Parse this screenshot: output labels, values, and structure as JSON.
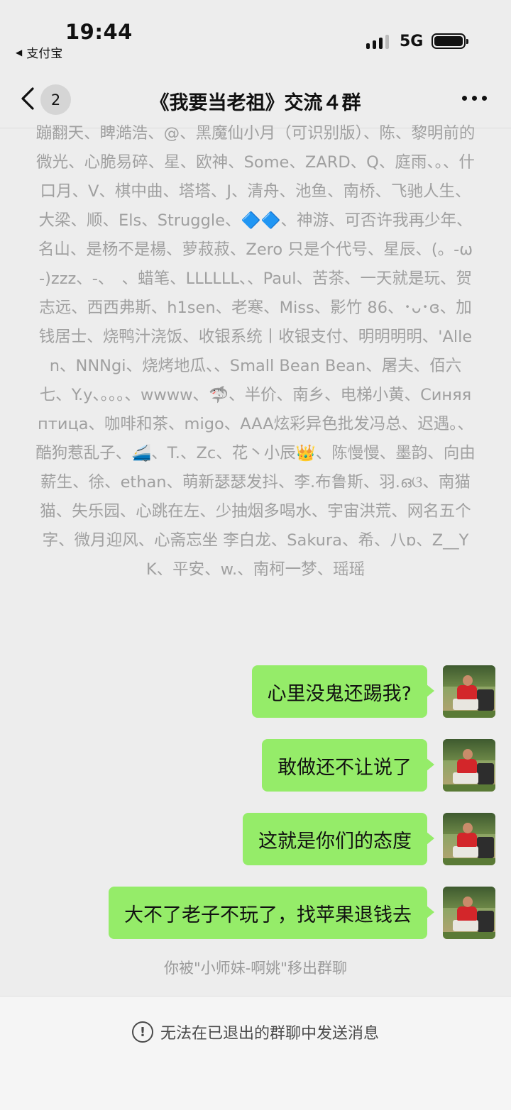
{
  "status_bar": {
    "time": "19:44",
    "back_app": "支付宝",
    "network": "5G"
  },
  "nav": {
    "unread_count": "2",
    "title": "《我要当老祖》交流４群"
  },
  "system_names_text": "蹦翻天、睥澔浩、@、黑魔仙小月（可识别版）、陈、黎明前的微光、心脆易碎、星、欧神、Some、ZARD、Q、庭雨、。、什口月、V、棋中曲、塔塔、J、清舟、池鱼、南桥、飞驰人生、大梁、顺、Els、Struggle、🔷🔷、神游、可否许我再少年、名山、是杨不是楊、萝菽菽、Zero 只是个代号、星辰、(。-ω-)zzz、-、　、蜡笔、LLLLLL、、Paul、苦茶、一天就是玩、贺志远、西西弗斯、h1sen、老寒、Miss、影竹 86、･ᴗ･ɞ、加钱居士、烧鸭汁浇饭、收银系统丨收银支付、明明明明、'Allen、NNNgi、烧烤地瓜、、Small Bean Bean、屠夫、佰六七、Y.y、。。。、wwww、🦈、半价、南乡、电梯小黄、Синяя птица、咖啡和茶、migo、AAA炫彩异色批发冯总、迟遇。、酷狗惹乱子、🚄、T.、Zc、花丶小辰👑、陈慢慢、墨韵、向由薪生、徐、ethan、萌新瑟瑟发抖、李.布鲁斯、羽.ഒଓ、南猫猫、失乐园、心跳在左、少抽烟多喝水、宇宙洪荒、网名五个字、微月迎风、心斋忘坐 李白龙、Sakura、希、八ɒ、Z__YK、平安、w.、南柯一梦、瑶瑶",
  "messages": [
    {
      "text": "心里没鬼还踢我?"
    },
    {
      "text": "敢做还不让说了"
    },
    {
      "text": "这就是你们的态度"
    },
    {
      "text": "大不了老子不玩了，找苹果退钱去"
    }
  ],
  "removed_note": "你被\"小师妹-啊姚\"移出群聊",
  "footer_text": "无法在已退出的群聊中发送消息",
  "colors": {
    "bubble": "#95ec69",
    "background": "#ededed",
    "system_text": "#a0a0a0"
  }
}
